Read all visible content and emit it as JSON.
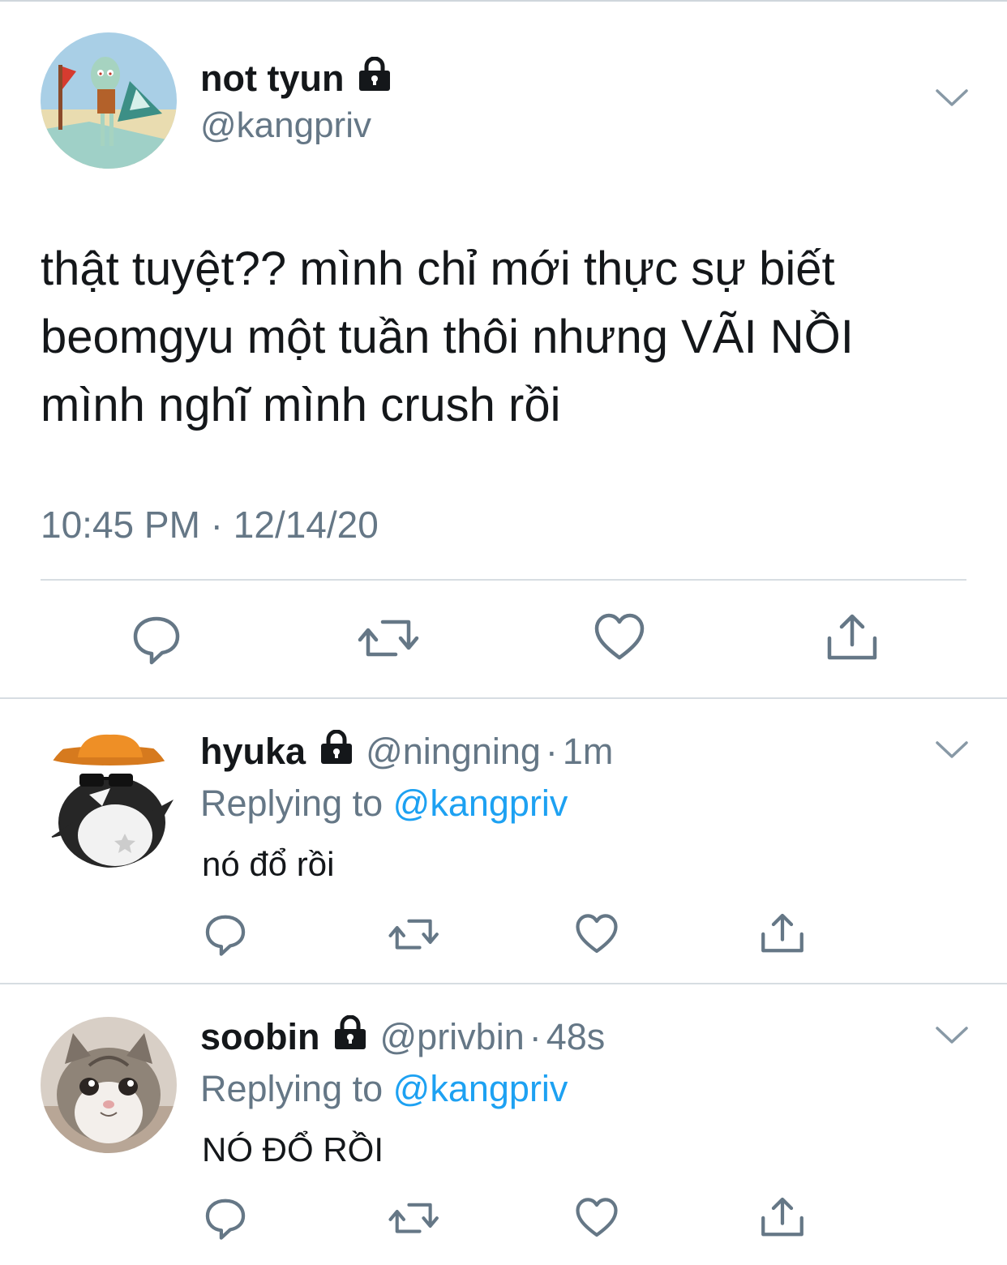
{
  "main_tweet": {
    "display_name": "not tyun",
    "handle": "@kangpriv",
    "text_lines": [
      "thật tuyệt?? mình chỉ mới thực sự biết",
      "beomgyu một tuần thôi nhưng VÃI NỒI",
      "mình nghĩ mình crush rồi"
    ],
    "timestamp": "10:45 PM · 12/14/20",
    "protected_icon": "lock-icon",
    "actions": [
      "reply-icon",
      "retweet-icon",
      "like-icon",
      "share-icon"
    ]
  },
  "replies": [
    {
      "display_name": "hyuka",
      "handle": "@ningning",
      "time": "1m",
      "replying_prefix": "Replying to",
      "replying_to": "@kangpriv",
      "text": "nó đổ rồi",
      "avatar": "penguin-cowboy-avatar"
    },
    {
      "display_name": "soobin",
      "handle": "@privbin",
      "time": "48s",
      "replying_prefix": "Replying to",
      "replying_to": "@kangpriv",
      "text": "NÓ ĐỔ RỒI",
      "avatar": "kitten-avatar"
    }
  ],
  "colors": {
    "text": "#14171a",
    "secondary": "#657786",
    "link": "#1da1f2",
    "divider": "#d7dde2"
  }
}
